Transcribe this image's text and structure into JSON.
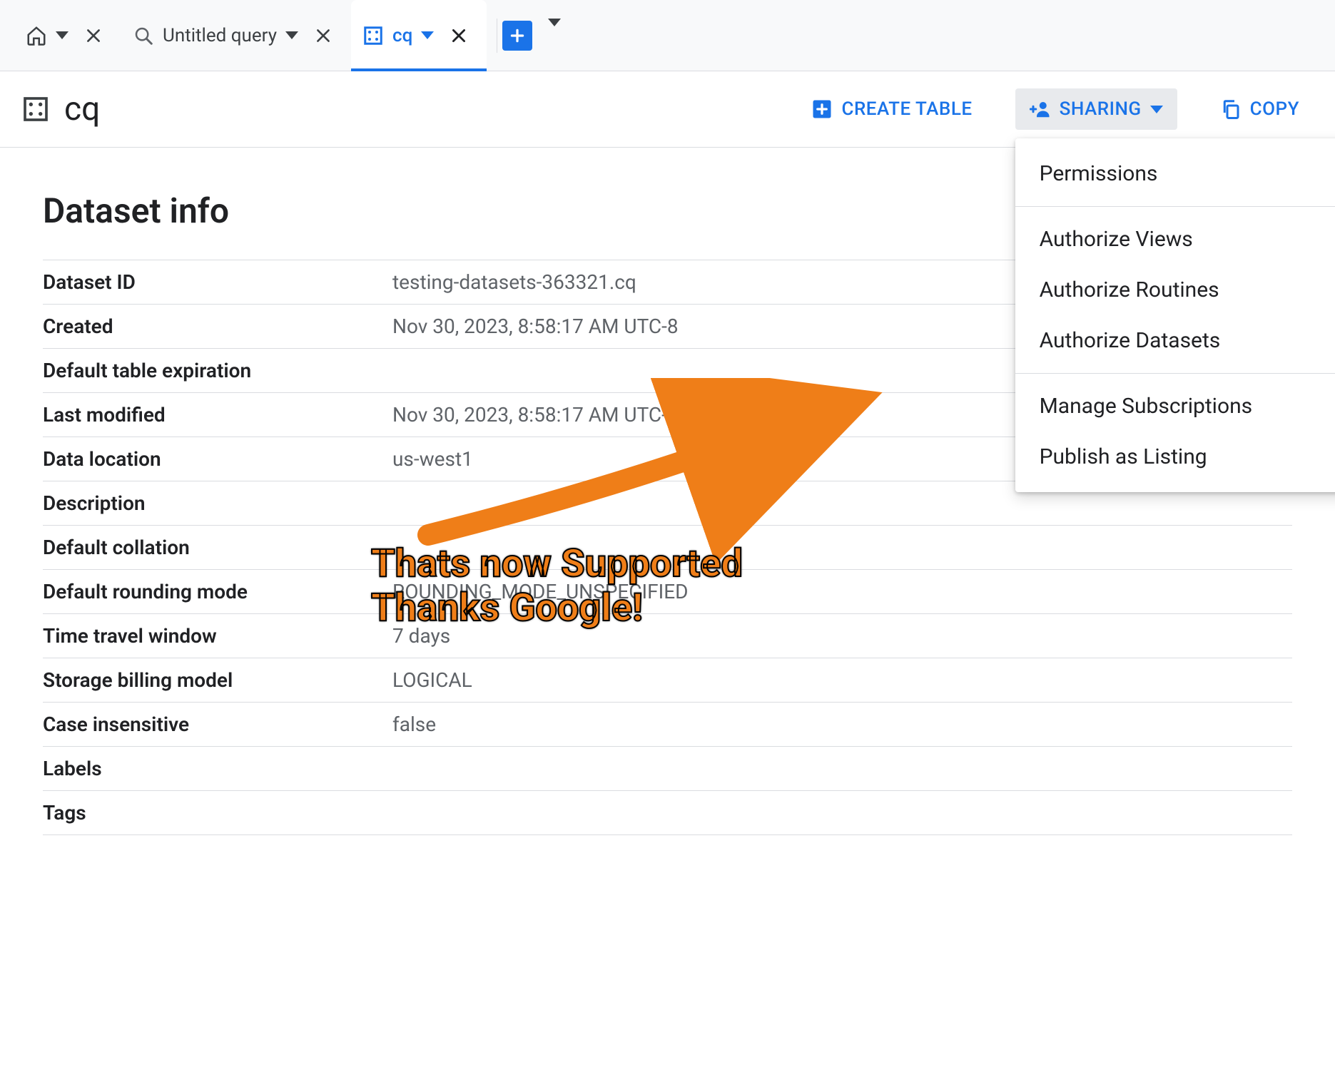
{
  "tabs": {
    "home_label": "",
    "query_label": "Untitled query",
    "dataset_label": "cq"
  },
  "header": {
    "title": "cq",
    "create_table_label": "CREATE TABLE",
    "sharing_label": "SHARING",
    "copy_label": "COPY"
  },
  "sharing_menu": {
    "permissions": "Permissions",
    "authorize_views": "Authorize Views",
    "authorize_routines": "Authorize Routines",
    "authorize_datasets": "Authorize Datasets",
    "manage_subscriptions": "Manage Subscriptions",
    "publish_as_listing": "Publish as Listing"
  },
  "dataset_info": {
    "heading": "Dataset info",
    "rows": [
      {
        "label": "Dataset ID",
        "value": "testing-datasets-363321.cq"
      },
      {
        "label": "Created",
        "value": "Nov 30, 2023, 8:58:17 AM UTC-8"
      },
      {
        "label": "Default table expiration",
        "value": ""
      },
      {
        "label": "Last modified",
        "value": "Nov 30, 2023, 8:58:17 AM UTC-8"
      },
      {
        "label": "Data location",
        "value": "us-west1"
      },
      {
        "label": "Description",
        "value": ""
      },
      {
        "label": "Default collation",
        "value": ""
      },
      {
        "label": "Default rounding mode",
        "value": "ROUNDING_MODE_UNSPECIFIED"
      },
      {
        "label": "Time travel window",
        "value": "7 days"
      },
      {
        "label": "Storage billing model",
        "value": "LOGICAL"
      },
      {
        "label": "Case insensitive",
        "value": "false"
      },
      {
        "label": "Labels",
        "value": ""
      },
      {
        "label": "Tags",
        "value": ""
      }
    ]
  },
  "annotation": {
    "line1": "Thats now Supported",
    "line2": "Thanks Google!",
    "arrow_color": "#ef7e18"
  }
}
